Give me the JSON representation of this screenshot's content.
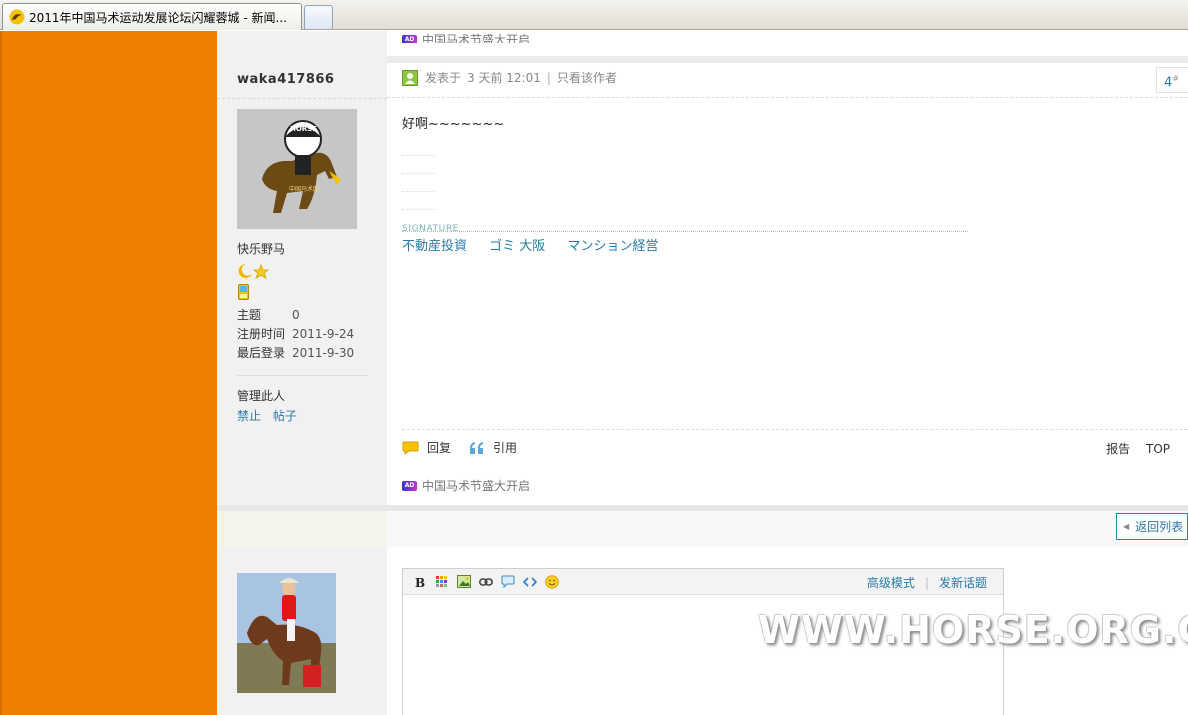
{
  "browser": {
    "tab_title": "2011年中国马术运动发展论坛闪耀蓉城 - 新闻..."
  },
  "ads": {
    "badge": "AD",
    "text": "中国马术节盛大开启"
  },
  "user": {
    "name": "waka417866",
    "rank": "快乐野马",
    "stats": [
      {
        "label": "主题",
        "value": "0"
      },
      {
        "label": "注册时间",
        "value": "2011-9-24"
      },
      {
        "label": "最后登录",
        "value": "2011-9-30"
      }
    ],
    "manage_title": "管理此人",
    "manage_links": [
      "禁止",
      "帖子"
    ]
  },
  "post": {
    "posted_label": "发表于",
    "posted_time": "3 天前 12:01",
    "author_only": "只看该作者",
    "floor_number": "4",
    "floor_mark": "#",
    "message": "好啊~~~~~~~",
    "signature_label": "SIGNATURE",
    "signature_links": [
      "不動産投資",
      "ゴミ 大阪",
      "マンション経営"
    ],
    "actions": {
      "reply": "回复",
      "quote": "引用",
      "report": "报告",
      "top": "TOP"
    }
  },
  "pagination": {
    "back_label": "返回列表"
  },
  "quick_reply": {
    "advanced_mode": "高级模式",
    "new_topic": "发新话题"
  },
  "watermark": "WWW.HORSE.ORG.CN",
  "colors": {
    "sidebar_orange": "#ef7f00",
    "link_blue": "#2a7aa8"
  }
}
